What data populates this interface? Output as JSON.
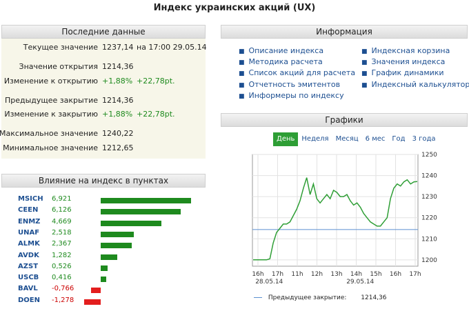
{
  "page_title": "Индекс украинских акций (UX)",
  "latest": {
    "header": "Последние данные",
    "current_label": "Текущее значение",
    "current_value": "1237,14",
    "current_time": "на 17:00 29.05.14",
    "open_label": "Значение открытия",
    "open_value": "1214,36",
    "change_open_label": "Изменение к открытию",
    "change_open_pct": "+1,88%",
    "change_open_pt": "+22,78pt.",
    "prev_close_label": "Предыдущее закрытие",
    "prev_close_value": "1214,36",
    "change_close_label": "Изменение к закрытию",
    "change_close_pct": "+1,88%",
    "change_close_pt": "+22,78pt.",
    "max_label": "Максимальное значение",
    "max_value": "1240,22",
    "min_label": "Минимальное значение",
    "min_value": "1212,65"
  },
  "influence": {
    "header": "Влияние на индекс в пунктах",
    "items": [
      {
        "ticker": "MSICH",
        "value": "6,921",
        "num": 6.921
      },
      {
        "ticker": "CEEN",
        "value": "6,126",
        "num": 6.126
      },
      {
        "ticker": "ENMZ",
        "value": "4,669",
        "num": 4.669
      },
      {
        "ticker": "UNAF",
        "value": "2,518",
        "num": 2.518
      },
      {
        "ticker": "ALMK",
        "value": "2,367",
        "num": 2.367
      },
      {
        "ticker": "AVDK",
        "value": "1,282",
        "num": 1.282
      },
      {
        "ticker": "AZST",
        "value": "0,526",
        "num": 0.526
      },
      {
        "ticker": "USCB",
        "value": "0,416",
        "num": 0.416
      },
      {
        "ticker": "BAVL",
        "value": "-0,766",
        "num": -0.766
      },
      {
        "ticker": "DOEN",
        "value": "-1,278",
        "num": -1.278
      }
    ],
    "positive_color": "#1e8a1e",
    "negative_color": "#e31e1e"
  },
  "info": {
    "header": "Информация",
    "left_links": [
      "Описание индекса",
      "Методика расчета",
      "Список акций для расчета",
      "Отчетность эмитентов",
      "Информеры по индексу"
    ],
    "right_links": [
      "Индексная корзина",
      "Значения индекса",
      "График динамики",
      "Индексный калькулятор"
    ]
  },
  "charts": {
    "header": "Графики",
    "tabs": [
      "День",
      "Неделя",
      "Месяц",
      "6 мес",
      "Год",
      "3 года"
    ],
    "active_tab": "День",
    "legend_label": "Предыдущее закрытие:",
    "legend_value": "1214,36",
    "line_color": "#2e9e35",
    "ref_color": "#5b8fd0"
  },
  "chart_data": {
    "type": "line",
    "x_tick_labels": [
      "16h",
      "17h",
      "11h",
      "12h",
      "13h",
      "14h",
      "15h",
      "16h",
      "17h"
    ],
    "x_date_labels": [
      "28.05.14",
      "29.05.14"
    ],
    "y_ticks": [
      1200,
      1210,
      1220,
      1230,
      1240,
      1250
    ],
    "ylim": [
      1197,
      1250
    ],
    "reference_value": 1214.36,
    "series": [
      {
        "values": [
          1200,
          1200,
          1200,
          1200,
          1200,
          1200.5,
          1208,
          1213,
          1215,
          1217,
          1217,
          1218,
          1221,
          1224,
          1228,
          1234,
          1239,
          1231,
          1236,
          1229,
          1227,
          1229,
          1231,
          1229,
          1233,
          1232,
          1230,
          1230,
          1231,
          1228,
          1226,
          1227,
          1225,
          1222,
          1220,
          1218,
          1217,
          1216,
          1216,
          1218,
          1220,
          1229,
          1234,
          1236,
          1235,
          1237,
          1238,
          1236,
          1237,
          1237.14
        ]
      }
    ]
  }
}
